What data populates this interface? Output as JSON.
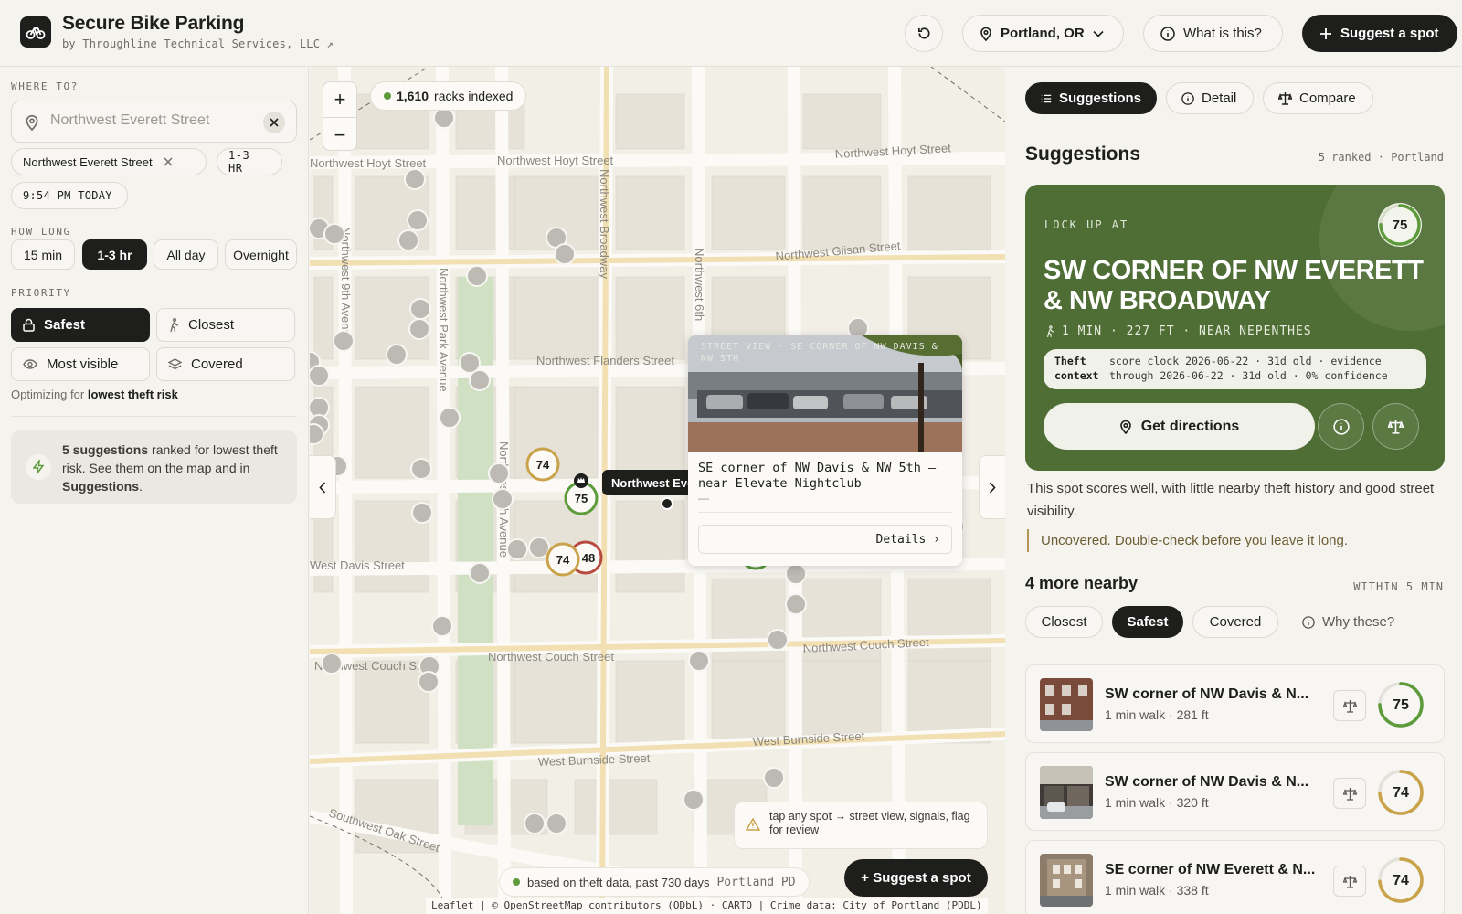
{
  "header": {
    "title": "Secure Bike Parking",
    "subtitle": "by Throughline Technical Services, LLC ↗",
    "city": "Portland, OR",
    "what_label": "What is this?",
    "suggest_label": "Suggest a spot"
  },
  "left": {
    "where_label": "WHERE TO?",
    "search_value": "",
    "search_placeholder": "Northwest Everett Street",
    "chips": {
      "street": "Northwest Everett Street",
      "duration": "1-3 HR",
      "time": "9:54 PM TODAY"
    },
    "how_long_label": "HOW LONG",
    "durations": [
      "15 min",
      "1-3 hr",
      "All day",
      "Overnight"
    ],
    "priority_label": "PRIORITY",
    "priorities": [
      "Safest",
      "Closest",
      "Most visible",
      "Covered"
    ],
    "optimizing_prefix": "Optimizing for",
    "optimizing_value": "lowest theft risk",
    "info": {
      "count": "5 suggestions",
      "text1": "ranked for lowest theft risk. See them on the map and in",
      "link": "Suggestions",
      "end": "."
    }
  },
  "map": {
    "racks_count": "1,610",
    "racks_label": "racks indexed",
    "streets": [
      "Northwest Hoyt Street",
      "Northwest Hoyt Street",
      "Northwest Hoyt Street",
      "Northwest Glisan Street",
      "Northwest Flanders Street",
      "West Davis Street",
      "Northwest Couch Street",
      "Northwest Couch Street",
      "Northwest Couch Street",
      "West Burnside Street",
      "West Burnside Street",
      "Southwest Oak Street",
      "Northwest Broadway",
      "Northwest 6th",
      "Northwest 9th Avenue",
      "Northwest Park Avenue",
      "Northwest 8th Avenue"
    ],
    "markers": [
      "74",
      "75",
      "74",
      "48",
      "73"
    ],
    "street_pill": "Northwest Everett Street",
    "popup": {
      "caption": "STREET VIEW · SE CORNER OF NW DAVIS & NW 5TH",
      "title": "SE corner of NW Davis & NW 5th — near Elevate Nightclub",
      "dash": "—",
      "details": "Details ›"
    },
    "tap_note": "tap any spot → street view, signals, flag for review",
    "theft_note": "based on theft data, past 730 days",
    "theft_source": "Portland PD",
    "suggest_label": "+ Suggest a spot",
    "attribution": "Leaflet | © OpenStreetMap contributors (ODbL) · CARTO | Crime data: City of Portland (PDDL)"
  },
  "right": {
    "tabs": [
      "Suggestions",
      "Detail",
      "Compare"
    ],
    "heading": "Suggestions",
    "meta": "5 ranked · Portland",
    "top": {
      "lock_label": "LOCK UP AT",
      "score": 75,
      "title": "SW CORNER OF NW EVERETT & NW BROADWAY",
      "walk": "1 MIN · 227 FT · NEAR NEPENTHES",
      "ctx_key1": "Theft",
      "ctx_key2": "context",
      "ctx_line1": "score clock 2026-06-22 · 31d old · evidence",
      "ctx_line2": "through 2026-06-22 · 31d old · 0% confidence",
      "directions": "Get directions"
    },
    "description": "This spot scores well, with little nearby theft history and good street visibility.",
    "caution": "Uncovered. Double-check before you leave it long.",
    "more_heading": "4 more nearby",
    "more_meta": "WITHIN 5 MIN",
    "filters": [
      "Closest",
      "Safest",
      "Covered"
    ],
    "why_label": "Why these?",
    "items": [
      {
        "title": "SW corner of NW Davis & N...",
        "sub": "1 min walk · 281 ft",
        "score": 75
      },
      {
        "title": "SW corner of NW Davis & N...",
        "sub": "1 min walk · 320 ft",
        "score": 74
      },
      {
        "title": "SE corner of NW Everett & N...",
        "sub": "1 min walk · 338 ft",
        "score": 74
      }
    ]
  },
  "colors": {
    "accent_green": "#4f6e35",
    "ring_green": "#5c9a3a",
    "ring_gold": "#c9a24a",
    "ring_red": "#b8493e",
    "dark": "#1e1e1c"
  }
}
